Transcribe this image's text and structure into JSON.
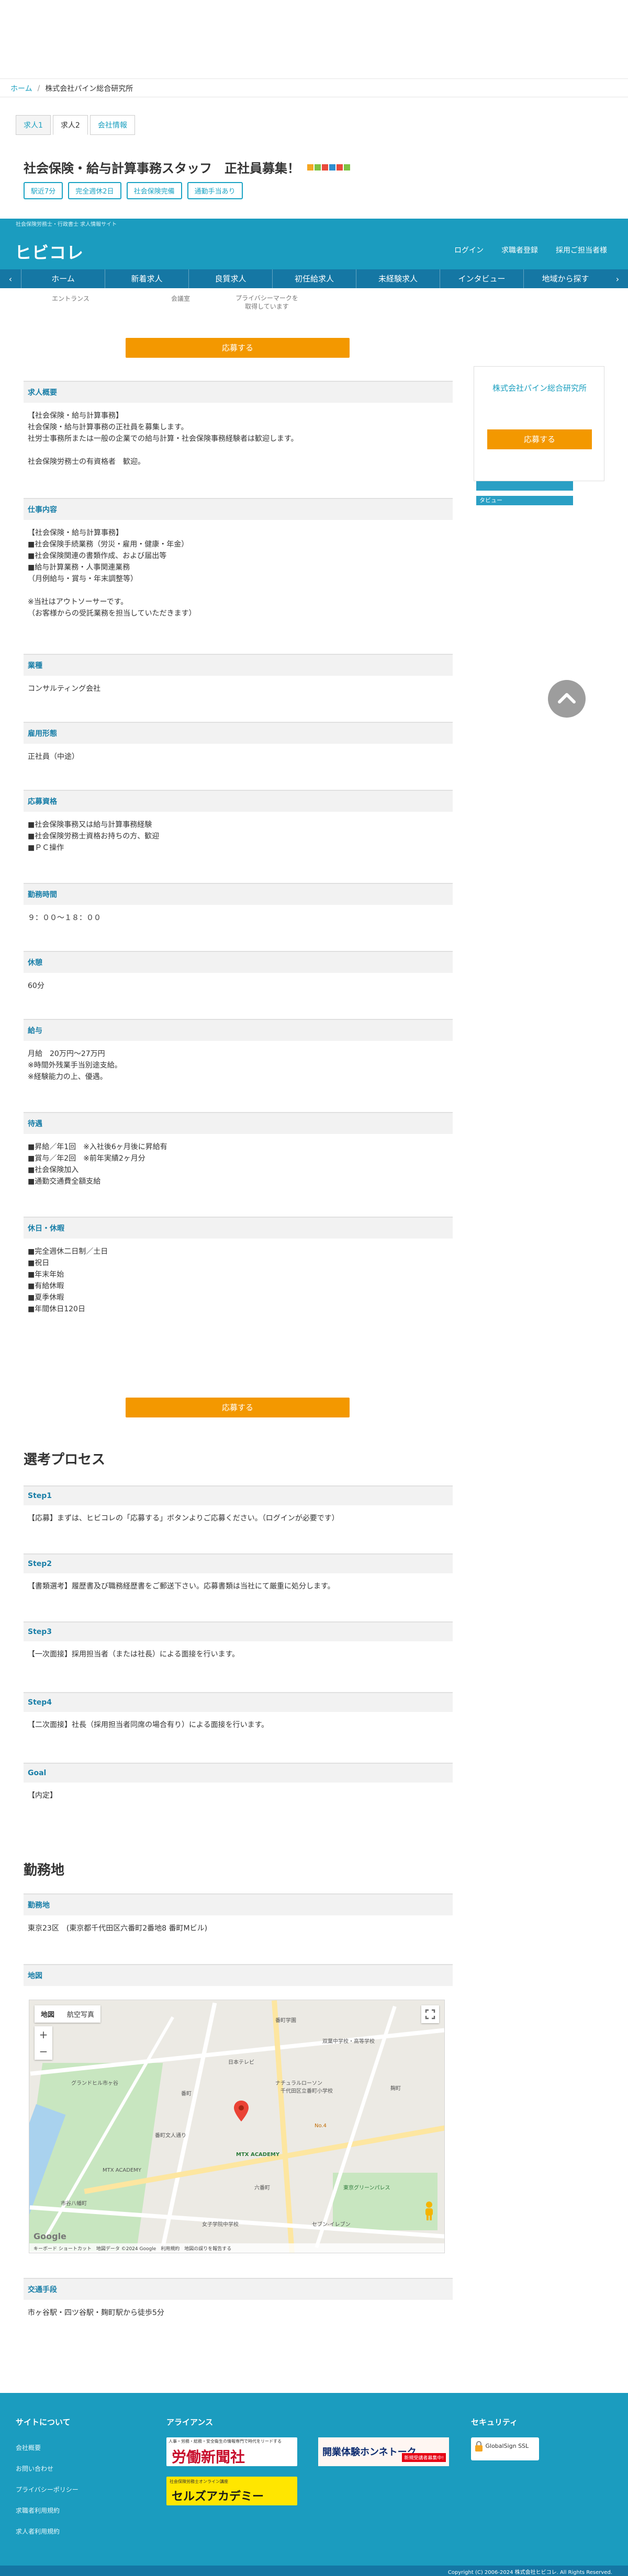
{
  "breadcrumb": {
    "home": "ホーム",
    "sep": "/",
    "current": "株式会社パイン総合研究所"
  },
  "tabs": [
    {
      "label": "求人1"
    },
    {
      "label": "求人2"
    },
    {
      "label": "会社情報"
    }
  ],
  "job": {
    "title": "社会保険・給与計算事務スタッフ　正社員募集！",
    "tags": [
      "駅近7分",
      "完全週休2日",
      "社会保険完備",
      "通勤手当あり"
    ]
  },
  "header": {
    "subtitle": "社会保険労務士・行政書士 求人情報サイト",
    "logo": "ヒビコレ",
    "links": [
      "ログイン",
      "求職者登録",
      "採用ご担当者様"
    ]
  },
  "nav": {
    "items": [
      "ホーム",
      "新着求人",
      "良質求人",
      "初任給求人",
      "未経験求人",
      "インタビュー",
      "地域から探す"
    ],
    "prev": "‹",
    "next": "›"
  },
  "photo_captions": [
    "エントランス",
    "会議室",
    "プライバシーマークを取得しています"
  ],
  "apply_label": "応募する",
  "sections": [
    {
      "head": "求人概要",
      "body": "【社会保険・給与計算事務】\n社会保険・給与計算事務の正社員を募集します。\n社労士事務所または一般の企業での給与計算・社会保険事務経験者は歓迎します。\n\n社会保険労務士の有資格者　歓迎。"
    },
    {
      "head": "仕事内容",
      "body": "【社会保険・給与計算事務】\n■社会保険手続業務（労災・雇用・健康・年金）\n■社会保険関連の書類作成、および届出等\n■給与計算業務・人事関連業務\n（月例給与・賞与・年末調整等）\n\n※当社はアウトソーサーです。\n（お客様からの受託業務を担当していただきます）"
    },
    {
      "head": "業種",
      "body": "コンサルティング会社"
    },
    {
      "head": "雇用形態",
      "body": "正社員（中途）"
    },
    {
      "head": "応募資格",
      "body": "■社会保険事務又は給与計算事務経験\n■社会保険労務士資格お持ちの方、歓迎\n■ＰＣ操作"
    },
    {
      "head": "勤務時間",
      "body": "９：００〜１８：００"
    },
    {
      "head": "休憩",
      "body": "60分"
    },
    {
      "head": "給与",
      "body": "月給　20万円〜27万円\n※時間外残業手当別途支給。\n※経験能力の上、優遇。"
    },
    {
      "head": "待遇",
      "body": "■昇給／年1回　※入社後6ヶ月後に昇給有\n■賞与／年2回　※前年実績2ヶ月分\n■社会保険加入\n■通勤交通費全額支給"
    },
    {
      "head": "休日・休暇",
      "body": "■完全週休二日制／土日\n■祝日\n■年末年始\n■有給休暇\n■夏季休暇\n■年間休日120日"
    }
  ],
  "sidebar": {
    "company": "株式会社パイン総合研究所",
    "apply": "応募する",
    "strip_label": "タビュー"
  },
  "process": {
    "title": "選考プロセス",
    "steps": [
      {
        "head": "Step1",
        "body": "【応募】まずは、ヒビコレの「応募する」ボタンよりご応募ください。（ログインが必要です）"
      },
      {
        "head": "Step2",
        "body": "【書類選考】履歴書及び職務経歴書をご郵送下さい。応募書類は当社にて厳重に処分します。"
      },
      {
        "head": "Step3",
        "body": "【一次面接】採用担当者（または社長）による面接を行います。"
      },
      {
        "head": "Step4",
        "body": "【二次面接】社長（採用担当者同席の場合有り）による面接を行います。"
      },
      {
        "head": "Goal",
        "body": "【内定】"
      }
    ]
  },
  "location": {
    "title": "勤務地",
    "address_head": "勤務地",
    "address": "東京23区　(東京都千代田区六番町2番地8 番町Mビル)",
    "map_head": "地図",
    "access_head": "交通手段",
    "access": "市ヶ谷駅・四ツ谷駅・麹町駅から徒歩5分"
  },
  "map": {
    "btn_map": "地図",
    "btn_sat": "航空写真",
    "zoom_in": "+",
    "zoom_out": "−",
    "labels": [
      "番町学園",
      "双葉中学校・高等学校",
      "日本テレビ",
      "MTX ACADEMY",
      "番町",
      "グランドヒル市ヶ谷",
      "ナチュラルローソン",
      "千代田区立番町小学校",
      "No.4",
      "六番町",
      "麹町",
      "東京グリーンパレス",
      "セブン-イレブン",
      "番町文人通り",
      "女子学院中学校",
      "MTX ACADEMY",
      "市谷八幡町"
    ],
    "google": "Google",
    "footer_text": "キーボード ショートカット　地図データ ©2024 Google　利用規約　地図の誤りを報告する"
  },
  "footer": {
    "col1_title": "サイトについて",
    "col1_items": [
      "会社概要",
      "お問い合わせ",
      "プライバシーポリシー",
      "求職者利用規約",
      "求人者利用規約"
    ],
    "col2_title": "アライアンス",
    "ad1": "労働新聞社",
    "ad1_sub": "人事・労務・総務・安全衛生の情報専門で時代をリードする",
    "ad2": "開業体験ホンネトーク",
    "ad2_sub": "新規受講者募集中!",
    "ad3": "セルズアカデミー",
    "ad3_sub": "社会保険労務士オンライン講座",
    "col3_title": "セキュリティ",
    "security": "GlobalSign SSL",
    "copyright": "Copyright (C) 2006-2024 株式会社ヒビコレ. All Rights Reserved."
  }
}
